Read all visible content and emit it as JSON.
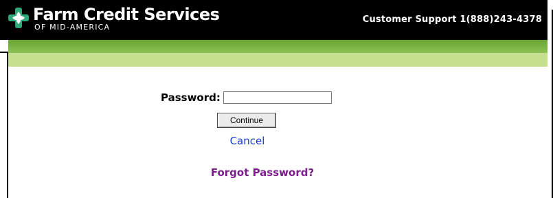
{
  "header": {
    "logo_title": "Farm Credit Services",
    "logo_subtitle": "OF MID-AMERICA",
    "support_text": "Customer Support 1(888)243-4378"
  },
  "login": {
    "password_label": "Password:",
    "password_value": "",
    "continue_label": "Continue",
    "cancel_label": "Cancel",
    "forgot_label": "Forgot Password?"
  },
  "colors": {
    "header_bg": "#000000",
    "band_dark": "#7cb342",
    "band_light": "#c5df8e",
    "logo_mark": "#2fa87a",
    "cancel_link": "#1a3cd8",
    "forgot_link": "#7b1f8a"
  },
  "icons": {
    "logo": "farm-credit-cross-leaf-icon"
  }
}
